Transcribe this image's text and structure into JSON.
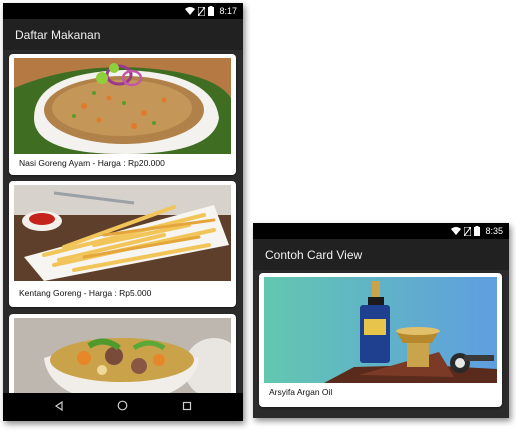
{
  "phone_a": {
    "status": {
      "time": "8:17"
    },
    "appbar": {
      "title": "Daftar Makanan"
    },
    "cards": [
      {
        "caption": "Nasi Goreng Ayam - Harga : Rp20.000",
        "image": "fried-rice-photo"
      },
      {
        "caption": "Kentang Goreng - Harga : Rp5.000",
        "image": "french-fries-photo"
      },
      {
        "caption": "",
        "image": "soup-photo"
      }
    ],
    "navbar": {
      "back": "back-icon",
      "home": "home-icon",
      "recents": "recents-icon"
    }
  },
  "phone_b": {
    "status": {
      "time": "8:35"
    },
    "appbar": {
      "title": "Contoh Card View"
    },
    "cards": [
      {
        "caption": "Arsyifa Argan Oil",
        "image": "argan-oil-photo"
      }
    ]
  }
}
